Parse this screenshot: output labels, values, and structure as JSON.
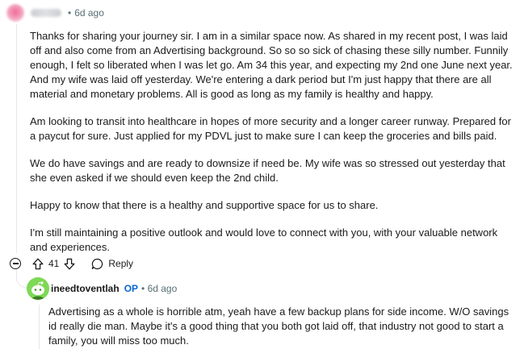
{
  "comment": {
    "age": "6d ago",
    "paragraphs": [
      "Thanks for sharing your journey sir. I am in a similar space now. As shared in my recent post, I was laid off and also come from an Advertising background. So so so sick of chasing these silly number. Funnily enough, I felt so liberated when I was let go. Am 34 this year, and expecting my 2nd one June next year. And my wife was laid off yesterday. We're entering a dark period but I'm just happy that there are all material and monetary problems. All is good as long as my family is healthy and happy.",
      "Am looking to transit into healthcare in hopes of more security and a longer career runway. Prepared for a paycut for sure. Just applied for my PDVL just to make sure I can keep the groceries and bills paid.",
      "We do have savings and are ready to downsize if need be. My wife was so stressed out yesterday that she even asked if we should even keep the 2nd child.",
      "Happy to know that there is a healthy and supportive space for us to share.",
      "I'm still maintaining a positive outlook and would love to connect with you, with your valuable network and experiences."
    ],
    "actions": {
      "vote_count": "41",
      "reply_label": "Reply"
    }
  },
  "reply": {
    "username": "ineedtoventlah",
    "badge": "OP",
    "age": "6d ago",
    "text": "Advertising as a whole is horrible atm, yeah have a few backup plans for side income. W/O savings id really die man. Maybe it's a good thing that you both got laid off, that industry not good to start a family, you will miss too much."
  },
  "colors": {
    "text": "#1a1a1b",
    "meta": "#576f76",
    "op_badge": "#0a66d1",
    "avatar_green": "#7ed957",
    "thread_line": "#e5e7eb"
  },
  "icons": [
    "collapse-icon",
    "upvote-icon",
    "downvote-icon",
    "reply-bubble-icon",
    "snoo-avatar"
  ]
}
